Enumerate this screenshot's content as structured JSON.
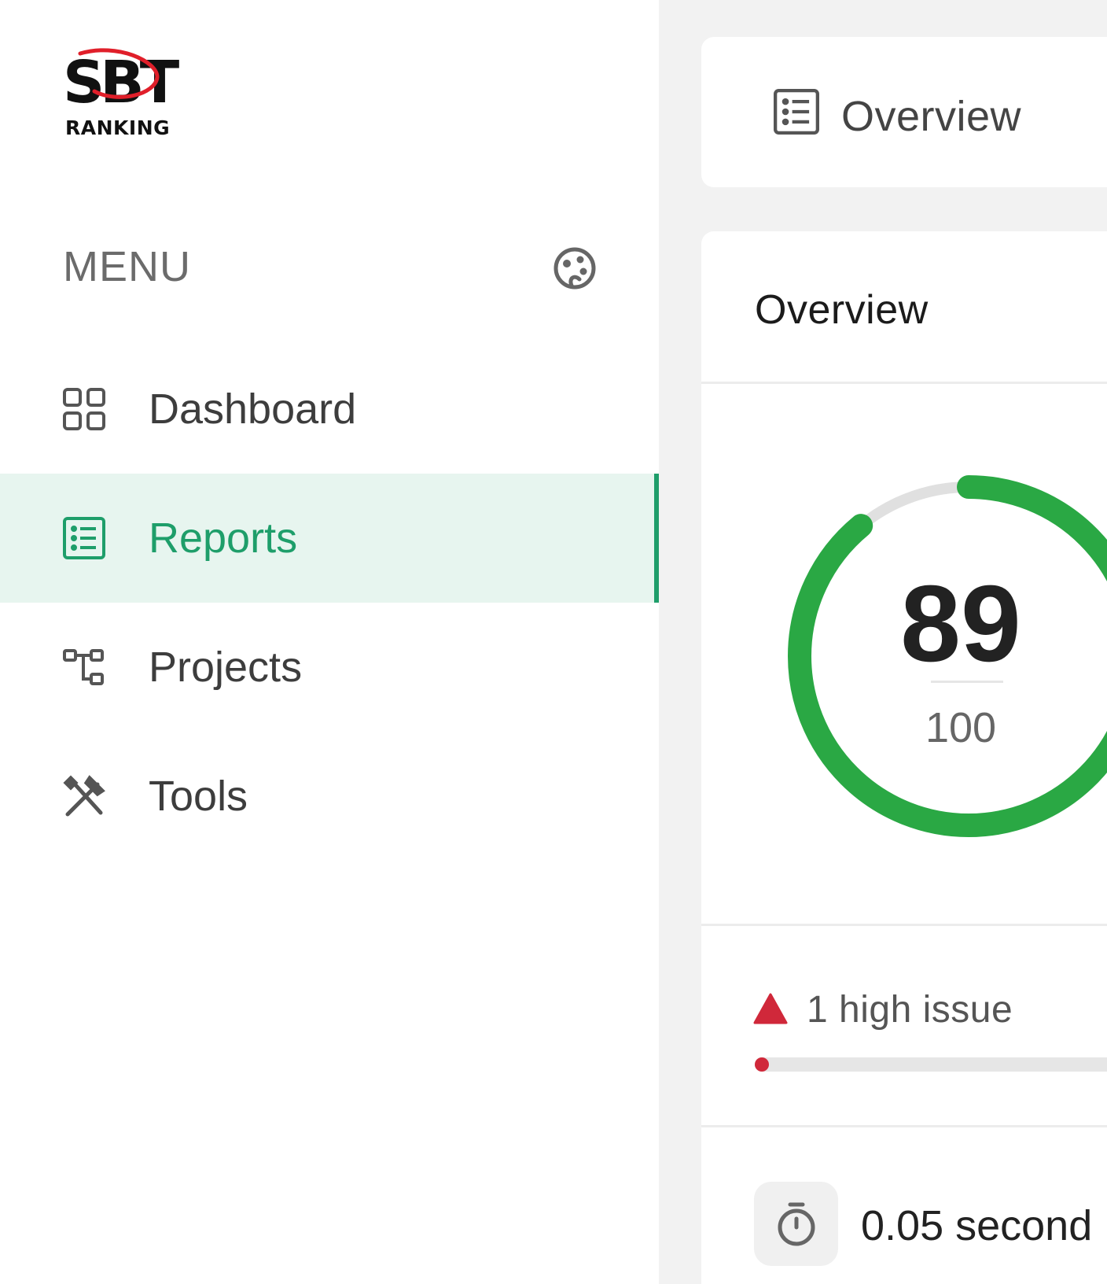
{
  "logo": {
    "brand": "SBT",
    "text": "RANKING"
  },
  "sidebar": {
    "menu_title": "MENU",
    "items": [
      {
        "label": "Dashboard",
        "icon": "grid-icon",
        "active": false
      },
      {
        "label": "Reports",
        "icon": "list-icon",
        "active": true
      },
      {
        "label": "Projects",
        "icon": "hierarchy-icon",
        "active": false
      },
      {
        "label": "Tools",
        "icon": "tools-icon",
        "active": false
      }
    ]
  },
  "header": {
    "title": "Overview",
    "icon": "list-icon"
  },
  "overview": {
    "title": "Overview",
    "score": "89",
    "score_max": "100",
    "score_fraction": 0.89,
    "issues_text": "1 high issue",
    "issues_fraction": 0.01,
    "time_text": "0.05 second",
    "timer_icon": "stopwatch-icon"
  },
  "colors": {
    "accent_green": "#1e9e6a",
    "gauge_green": "#2aa844",
    "gauge_track": "#e0e0e0",
    "danger_red": "#d0283a",
    "active_bg": "#e7f5ef"
  }
}
